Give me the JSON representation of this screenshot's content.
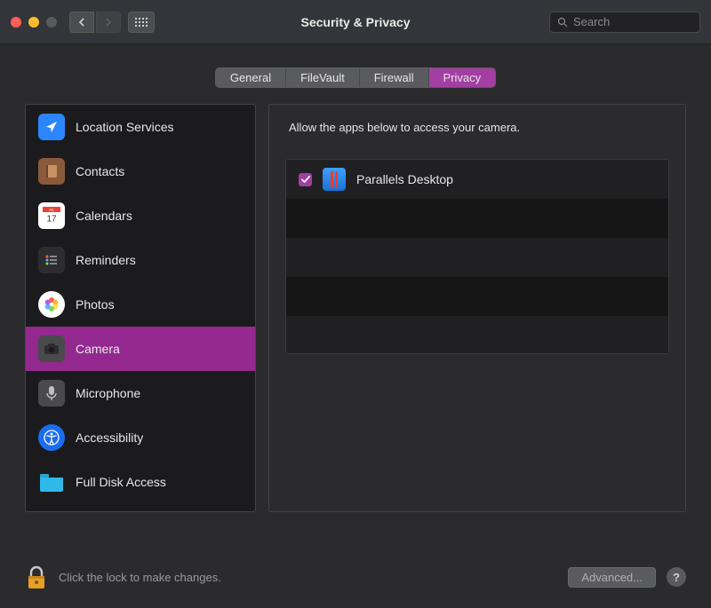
{
  "window": {
    "title": "Security & Privacy",
    "search_placeholder": "Search"
  },
  "tabs": [
    {
      "label": "General",
      "selected": false
    },
    {
      "label": "FileVault",
      "selected": false
    },
    {
      "label": "Firewall",
      "selected": false
    },
    {
      "label": "Privacy",
      "selected": true
    }
  ],
  "sidebar": {
    "items": [
      {
        "label": "Location Services",
        "icon": "location",
        "selected": false
      },
      {
        "label": "Contacts",
        "icon": "contacts",
        "selected": false
      },
      {
        "label": "Calendars",
        "icon": "calendar",
        "selected": false
      },
      {
        "label": "Reminders",
        "icon": "reminders",
        "selected": false
      },
      {
        "label": "Photos",
        "icon": "photos",
        "selected": false
      },
      {
        "label": "Camera",
        "icon": "camera",
        "selected": true
      },
      {
        "label": "Microphone",
        "icon": "microphone",
        "selected": false
      },
      {
        "label": "Accessibility",
        "icon": "accessibility",
        "selected": false
      },
      {
        "label": "Full Disk Access",
        "icon": "disk",
        "selected": false
      }
    ]
  },
  "main": {
    "prompt": "Allow the apps below to access your camera.",
    "apps": [
      {
        "name": "Parallels Desktop",
        "checked": true
      }
    ]
  },
  "footer": {
    "lock_text": "Click the lock to make changes.",
    "advanced_label": "Advanced...",
    "help_label": "?"
  }
}
